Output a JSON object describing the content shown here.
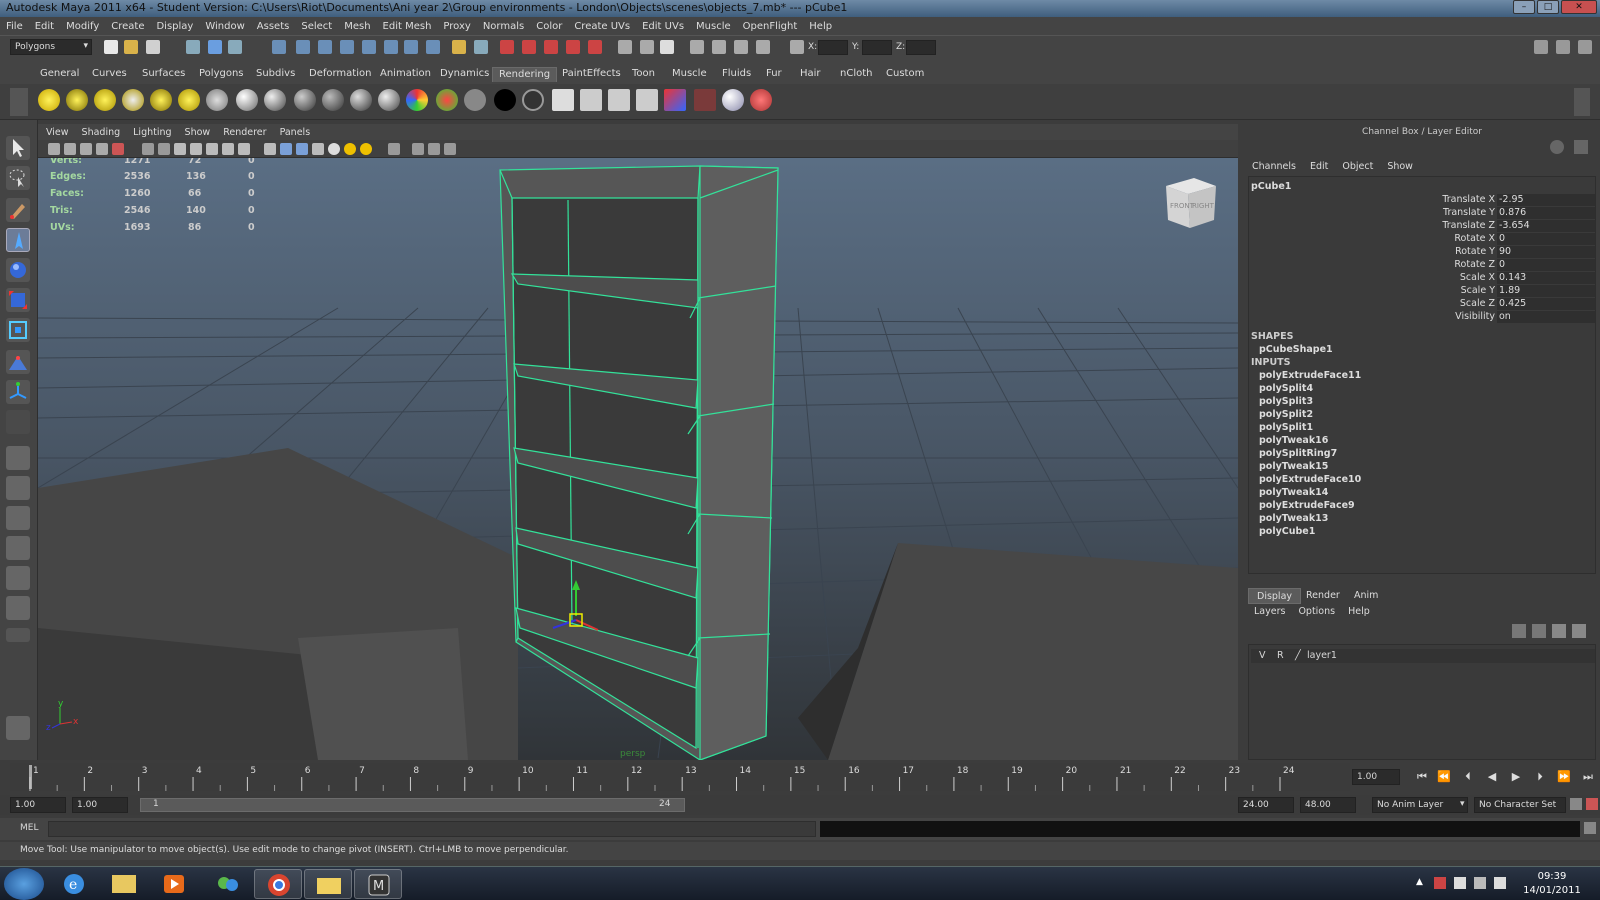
{
  "window": {
    "title": "Autodesk Maya 2011 x64 - Student Version: C:\\Users\\Riot\\Documents\\Ani year 2\\Group environments - London\\Objects\\scenes\\objects_7.mb*  ---  pCube1",
    "minimize": "–",
    "maximize": "□",
    "close": "✕"
  },
  "menu": [
    "File",
    "Edit",
    "Modify",
    "Create",
    "Display",
    "Window",
    "Assets",
    "Select",
    "Mesh",
    "Edit Mesh",
    "Proxy",
    "Normals",
    "Color",
    "Create UVs",
    "Edit UVs",
    "Muscle",
    "OpenFlight",
    "Help"
  ],
  "statusline": {
    "mode": "Polygons",
    "x_label": "X:",
    "y_label": "Y:",
    "z_label": "Z:"
  },
  "shelf_tabs": [
    "General",
    "Curves",
    "Surfaces",
    "Polygons",
    "Subdivs",
    "Deformation",
    "Animation",
    "Dynamics",
    "Rendering",
    "PaintEffects",
    "Toon",
    "Muscle",
    "Fluids",
    "Fur",
    "Hair",
    "nCloth",
    "Custom"
  ],
  "shelf_active": "Rendering",
  "viewport": {
    "menu": [
      "View",
      "Shading",
      "Lighting",
      "Show",
      "Renderer",
      "Panels"
    ],
    "hud": {
      "rows": [
        {
          "label": "Verts:",
          "v1": "1271",
          "v2": "72",
          "v3": "0"
        },
        {
          "label": "Edges:",
          "v1": "2536",
          "v2": "136",
          "v3": "0"
        },
        {
          "label": "Faces:",
          "v1": "1260",
          "v2": "66",
          "v3": "0"
        },
        {
          "label": "Tris:",
          "v1": "2546",
          "v2": "140",
          "v3": "0"
        },
        {
          "label": "UVs:",
          "v1": "1693",
          "v2": "86",
          "v3": "0"
        }
      ]
    },
    "viewcube": {
      "front": "FRONT",
      "right": "RIGHT"
    },
    "camera_label": "persp",
    "axis": {
      "y": "y",
      "x": "x",
      "z": "z"
    }
  },
  "channel_box": {
    "title": "Channel Box / Layer Editor",
    "menu": [
      "Channels",
      "Edit",
      "Object",
      "Show"
    ],
    "object": "pCube1",
    "attributes": [
      {
        "name": "Translate X",
        "value": "-2.95"
      },
      {
        "name": "Translate Y",
        "value": "0.876"
      },
      {
        "name": "Translate Z",
        "value": "-3.654"
      },
      {
        "name": "Rotate X",
        "value": "0"
      },
      {
        "name": "Rotate Y",
        "value": "90"
      },
      {
        "name": "Rotate Z",
        "value": "0"
      },
      {
        "name": "Scale X",
        "value": "0.143"
      },
      {
        "name": "Scale Y",
        "value": "1.89"
      },
      {
        "name": "Scale Z",
        "value": "0.425"
      },
      {
        "name": "Visibility",
        "value": "on"
      }
    ],
    "shapes_label": "SHAPES",
    "shape": "pCubeShape1",
    "inputs_label": "INPUTS",
    "inputs": [
      "polyExtrudeFace11",
      "polySplit4",
      "polySplit3",
      "polySplit2",
      "polySplit1",
      "polyTweak16",
      "polySplitRing7",
      "polyTweak15",
      "polyExtrudeFace10",
      "polyTweak14",
      "polyExtrudeFace9",
      "polyTweak13",
      "polyCube1"
    ]
  },
  "layer_editor": {
    "tabs": [
      "Display",
      "Render",
      "Anim"
    ],
    "active_tab": "Display",
    "menu": [
      "Layers",
      "Options",
      "Help"
    ],
    "layer": {
      "v": "V",
      "r": "R",
      "name": "layer1"
    }
  },
  "timeline": {
    "ticks": [
      "1",
      "2",
      "3",
      "4",
      "5",
      "6",
      "7",
      "8",
      "9",
      "10",
      "11",
      "12",
      "13",
      "14",
      "15",
      "16",
      "17",
      "18",
      "19",
      "20",
      "21",
      "22",
      "23",
      "24"
    ],
    "current_frame": "1.00",
    "start": "1.00",
    "playback_start": "1.00",
    "range_start_label": "1",
    "range_end_label": "24",
    "playback_end": "24.00",
    "end": "48.00",
    "anim_layer": "No Anim Layer",
    "character_set": "No Character Set"
  },
  "command_line": {
    "label": "MEL"
  },
  "help_line": "Move Tool: Use manipulator to move object(s). Use edit mode to change pivot (INSERT). Ctrl+LMB to move perpendicular.",
  "taskbar": {
    "time": "09:39",
    "date": "14/01/2011"
  }
}
